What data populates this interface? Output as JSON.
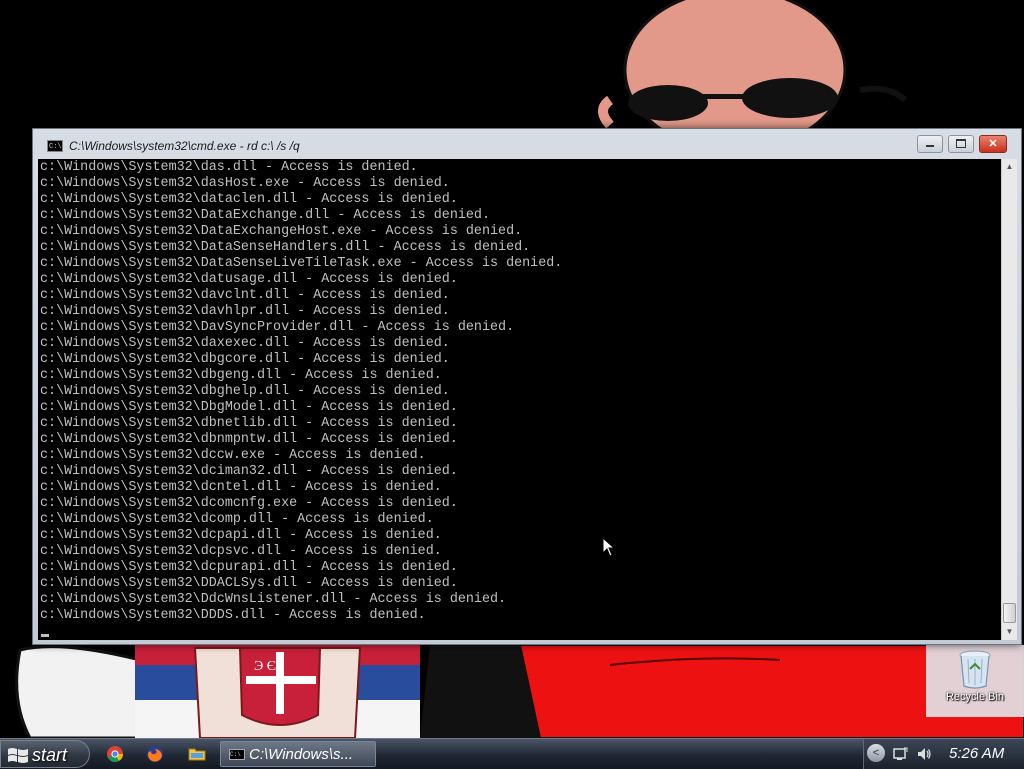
{
  "window": {
    "title": "C:\\Windows\\system32\\cmd.exe - rd  c:\\ /s /q",
    "app_icon_text": "C:\\",
    "minimize": "minimize",
    "maximize": "maximize",
    "close": "✕"
  },
  "console": {
    "lines": [
      "c:\\Windows\\System32\\das.dll - Access is denied.",
      "c:\\Windows\\System32\\dasHost.exe - Access is denied.",
      "c:\\Windows\\System32\\dataclen.dll - Access is denied.",
      "c:\\Windows\\System32\\DataExchange.dll - Access is denied.",
      "c:\\Windows\\System32\\DataExchangeHost.exe - Access is denied.",
      "c:\\Windows\\System32\\DataSenseHandlers.dll - Access is denied.",
      "c:\\Windows\\System32\\DataSenseLiveTileTask.exe - Access is denied.",
      "c:\\Windows\\System32\\datusage.dll - Access is denied.",
      "c:\\Windows\\System32\\davclnt.dll - Access is denied.",
      "c:\\Windows\\System32\\davhlpr.dll - Access is denied.",
      "c:\\Windows\\System32\\DavSyncProvider.dll - Access is denied.",
      "c:\\Windows\\System32\\daxexec.dll - Access is denied.",
      "c:\\Windows\\System32\\dbgcore.dll - Access is denied.",
      "c:\\Windows\\System32\\dbgeng.dll - Access is denied.",
      "c:\\Windows\\System32\\dbghelp.dll - Access is denied.",
      "c:\\Windows\\System32\\DbgModel.dll - Access is denied.",
      "c:\\Windows\\System32\\dbnetlib.dll - Access is denied.",
      "c:\\Windows\\System32\\dbnmpntw.dll - Access is denied.",
      "c:\\Windows\\System32\\dccw.exe - Access is denied.",
      "c:\\Windows\\System32\\dciman32.dll - Access is denied.",
      "c:\\Windows\\System32\\dcntel.dll - Access is denied.",
      "c:\\Windows\\System32\\dcomcnfg.exe - Access is denied.",
      "c:\\Windows\\System32\\dcomp.dll - Access is denied.",
      "c:\\Windows\\System32\\dcpapi.dll - Access is denied.",
      "c:\\Windows\\System32\\dcpsvc.dll - Access is denied.",
      "c:\\Windows\\System32\\dcpurapi.dll - Access is denied.",
      "c:\\Windows\\System32\\DDACLSys.dll - Access is denied.",
      "c:\\Windows\\System32\\DdcWnsListener.dll - Access is denied.",
      "c:\\Windows\\System32\\DDDS.dll - Access is denied."
    ]
  },
  "desktop": {
    "recycle_bin_label": "Recycle Bin"
  },
  "taskbar": {
    "start_label": "start",
    "quick_launch": [
      "chrome-icon",
      "firefox-icon",
      "folder-icon"
    ],
    "active_task_label": "C:\\Windows\\s...",
    "clock": "5:26 AM"
  },
  "colors": {
    "console_bg": "#000000",
    "console_text": "#c0c0c0",
    "close_button": "#c9321b",
    "wallpaper_red": "#ee1111"
  }
}
